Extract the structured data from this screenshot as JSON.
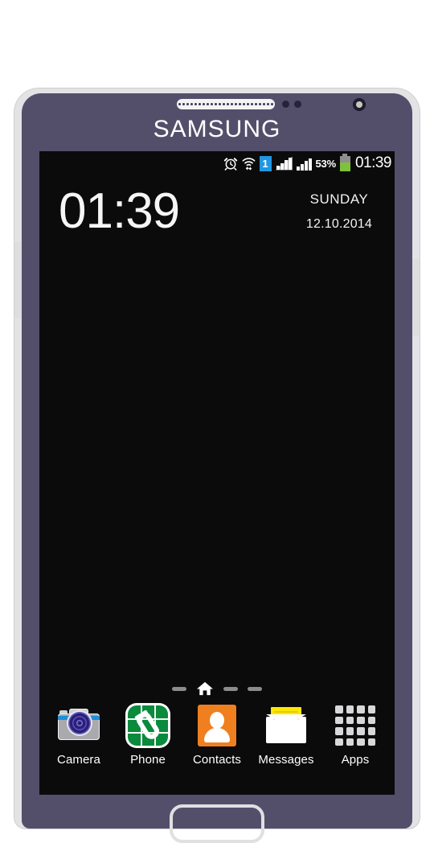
{
  "device": {
    "brand": "SAMSUNG",
    "brand_glyphs": {
      "s": "S",
      "a": "A",
      "rest": "MSUNG"
    },
    "hardware": {
      "speaker_grille": "speaker-grille",
      "proximity_sensor": "proximity-sensor",
      "front_camera": "front-camera",
      "volume_button": "volume-button",
      "power_button": "power-button",
      "home_button": "home-button"
    },
    "colors": {
      "bezel": "#534f6b",
      "shell": "#e3e3e5",
      "screen": "#0b0b0b"
    }
  },
  "status_bar": {
    "alarm_icon": "alarm-clock-icon",
    "wifi_icon": "wifi-icon",
    "sim_label": "1",
    "signal_1_icon": "signal-bars-sim1-icon",
    "signal_2_icon": "signal-bars-sim2-icon",
    "battery_percent": "53%",
    "battery_icon": "battery-icon",
    "battery_level": 53,
    "battery_color": "#7ec13a",
    "clock": "01:39"
  },
  "clock_widget": {
    "time": "01:39",
    "day": "SUNDAY",
    "date": "12.10.2014"
  },
  "page_indicator": {
    "pages": 4,
    "current": 2,
    "home_icon": "home-icon"
  },
  "dock": {
    "items": [
      {
        "label": "Camera",
        "icon": "camera-icon",
        "color": "#a9a9ae"
      },
      {
        "label": "Phone",
        "icon": "phone-icon",
        "color": "#0a8a3c"
      },
      {
        "label": "Contacts",
        "icon": "contacts-icon",
        "color": "#ef7f1f"
      },
      {
        "label": "Messages",
        "icon": "messages-icon",
        "color": "#ffe800"
      },
      {
        "label": "Apps",
        "icon": "apps-grid-icon",
        "color": "#d8d8da"
      }
    ]
  }
}
